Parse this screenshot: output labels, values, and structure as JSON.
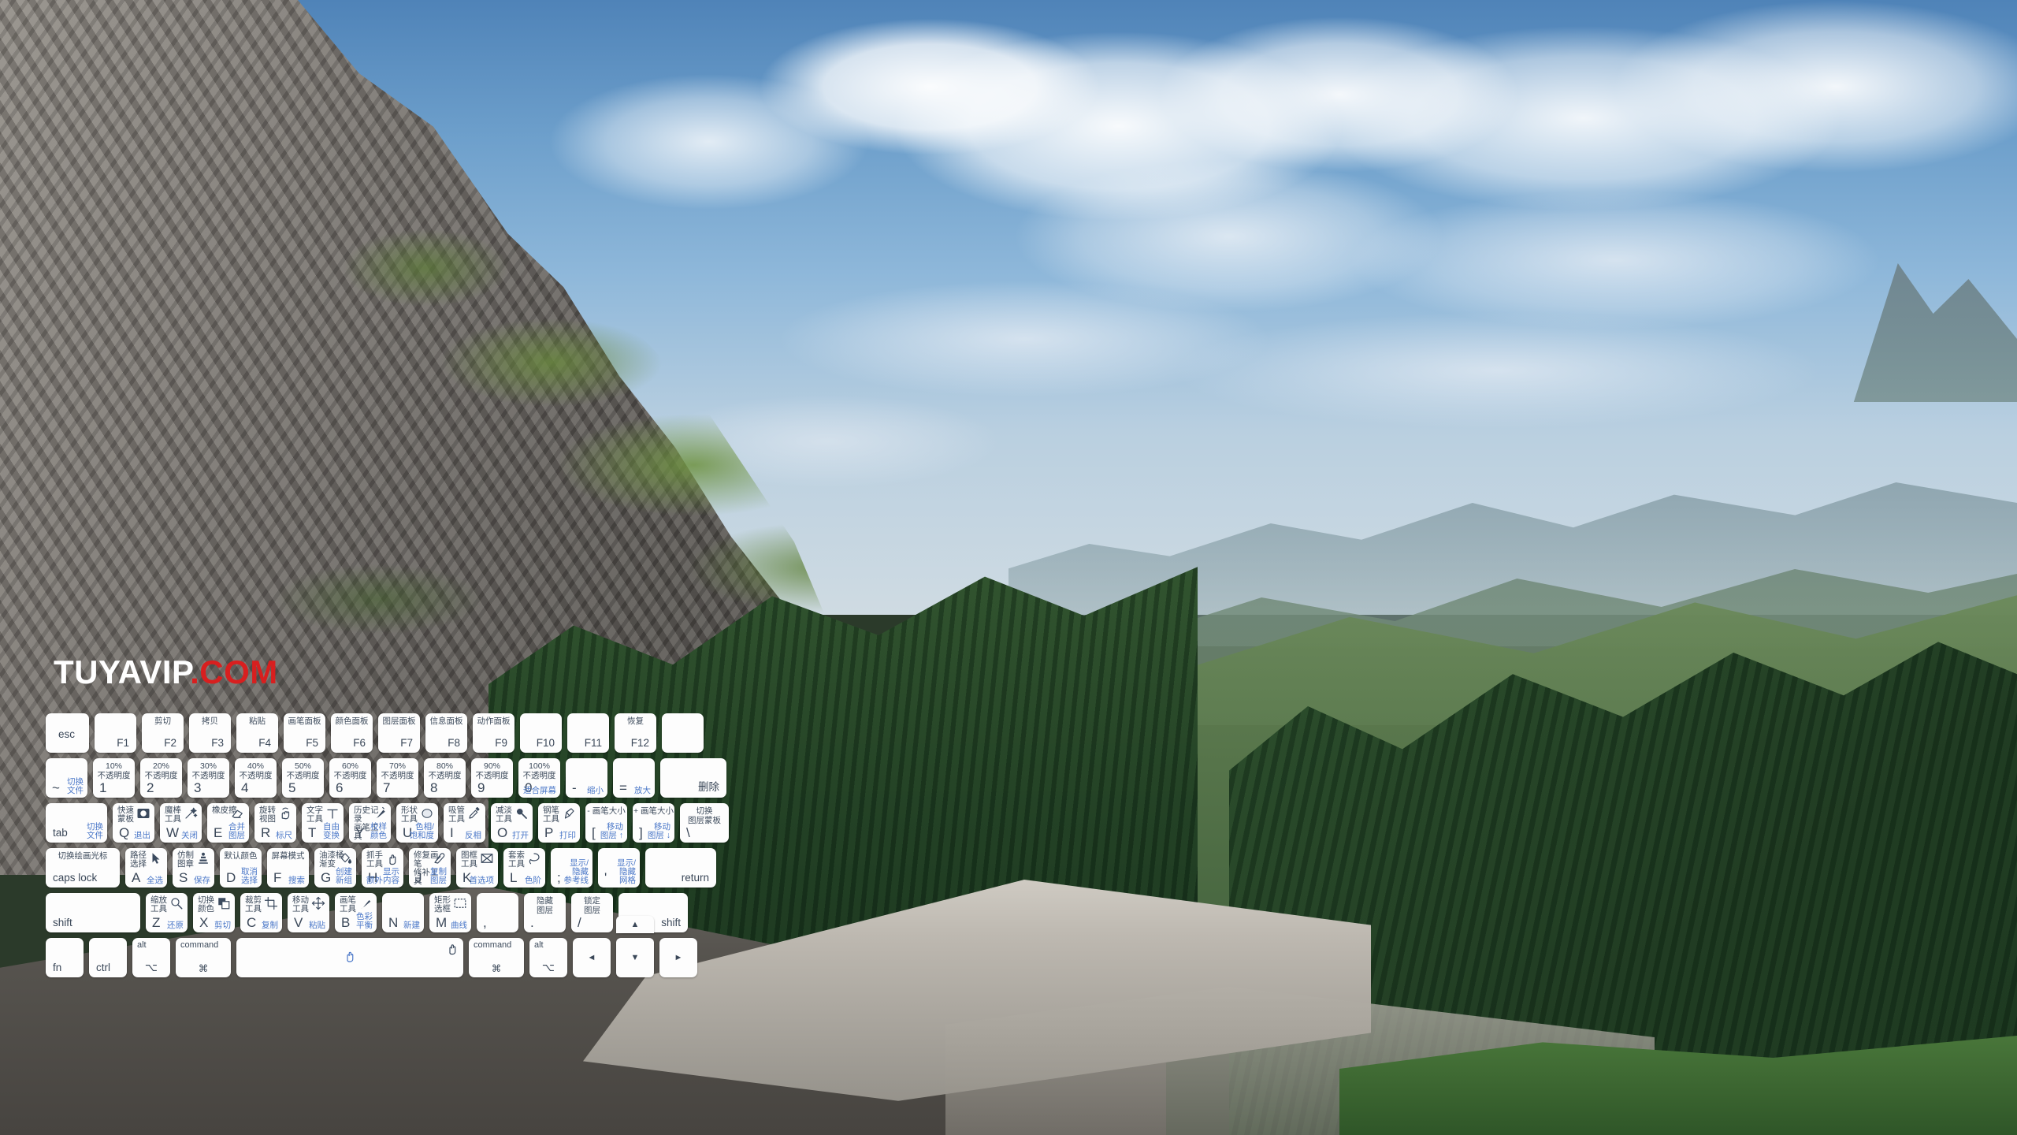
{
  "watermark": {
    "name": "TUYAVIP",
    "tld": ".COM"
  },
  "keyboard": {
    "fn_row": [
      {
        "key": "esc",
        "top": "",
        "wide": "esc"
      },
      {
        "key": "F1",
        "top": ""
      },
      {
        "key": "F2",
        "top": "剪切"
      },
      {
        "key": "F3",
        "top": "拷贝"
      },
      {
        "key": "F4",
        "top": "粘贴"
      },
      {
        "key": "F5",
        "top": "画笔面板"
      },
      {
        "key": "F6",
        "top": "颜色面板"
      },
      {
        "key": "F7",
        "top": "图层面板"
      },
      {
        "key": "F8",
        "top": "信息面板"
      },
      {
        "key": "F9",
        "top": "动作面板"
      },
      {
        "key": "F10",
        "top": ""
      },
      {
        "key": "F11",
        "top": ""
      },
      {
        "key": "F12",
        "top": "恢复"
      },
      {
        "key": "",
        "top": ""
      }
    ],
    "num_row": [
      {
        "key": "~",
        "top": "",
        "sub": "切换\n文件",
        "subcolor": "blue"
      },
      {
        "key": "1",
        "top": "10%\n不透明度"
      },
      {
        "key": "2",
        "top": "20%\n不透明度"
      },
      {
        "key": "3",
        "top": "30%\n不透明度"
      },
      {
        "key": "4",
        "top": "40%\n不透明度"
      },
      {
        "key": "5",
        "top": "50%\n不透明度"
      },
      {
        "key": "6",
        "top": "60%\n不透明度"
      },
      {
        "key": "7",
        "top": "70%\n不透明度"
      },
      {
        "key": "8",
        "top": "80%\n不透明度"
      },
      {
        "key": "9",
        "top": "90%\n不透明度"
      },
      {
        "key": "0",
        "top": "100%\n不透明度",
        "sub": "适合屏幕",
        "subcolor": "blue"
      },
      {
        "key": "-",
        "top": "",
        "sub": "缩小",
        "subcolor": "blue"
      },
      {
        "key": "=",
        "top": "",
        "sub": "放大",
        "subcolor": "blue"
      },
      {
        "key": "删除",
        "top": "",
        "wide": "del"
      }
    ],
    "qwerty_row": [
      {
        "key": "tab",
        "wide": "tab",
        "sub": "切换\n文件",
        "subcolor": "blue"
      },
      {
        "key": "Q",
        "top": "快速\n蒙板",
        "icon": "quick-mask-icon",
        "sub": "退出",
        "subcolor": "blue"
      },
      {
        "key": "W",
        "top": "魔棒\n工具",
        "icon": "magic-wand-icon",
        "sub": "关闭",
        "subcolor": "blue"
      },
      {
        "key": "E",
        "top": "橡皮擦",
        "icon": "eraser-icon",
        "sub": "合并\n图层",
        "subcolor": "blue"
      },
      {
        "key": "R",
        "top": "旋转\n视图",
        "icon": "rotate-view-icon",
        "sub": "标尺",
        "subcolor": "blue"
      },
      {
        "key": "T",
        "top": "文字\n工具",
        "icon": "text-tool-icon",
        "sub": "自由\n变换",
        "subcolor": "blue"
      },
      {
        "key": "Y",
        "top": "历史记录\n画笔工具",
        "icon": "history-brush-icon",
        "sub": "校样\n颜色",
        "subcolor": "blue"
      },
      {
        "key": "U",
        "top": "形状\n工具",
        "icon": "shape-tool-icon",
        "sub": "色相/\n饱和度",
        "subcolor": "blue"
      },
      {
        "key": "I",
        "top": "吸管\n工具",
        "icon": "eyedropper-icon",
        "sub": "反相",
        "subcolor": "blue"
      },
      {
        "key": "O",
        "top": "减淡\n工具",
        "icon": "dodge-tool-icon",
        "sub": "打开",
        "subcolor": "blue"
      },
      {
        "key": "P",
        "top": "钢笔\n工具",
        "icon": "pen-tool-icon",
        "sub": "打印",
        "subcolor": "blue"
      },
      {
        "key": "[",
        "top": "- 画笔大小",
        "sub": "移动\n图层 ↑",
        "subcolor": "blue"
      },
      {
        "key": "]",
        "top": "+ 画笔大小",
        "sub": "移动\n图层 ↓",
        "subcolor": "blue"
      },
      {
        "key": "\\",
        "top": "切换\n图层蒙板",
        "wide": "bsl"
      }
    ],
    "home_row": [
      {
        "key": "caps lock",
        "wide": "caps",
        "top": "切换绘画光标"
      },
      {
        "key": "A",
        "top": "路径\n选择",
        "icon": "path-select-icon",
        "sub": "全选",
        "subcolor": "blue"
      },
      {
        "key": "S",
        "top": "仿制\n图章",
        "icon": "clone-stamp-icon",
        "sub": "保存",
        "subcolor": "blue"
      },
      {
        "key": "D",
        "top": "默认颜色",
        "sub": "取消\n选择",
        "subcolor": "blue"
      },
      {
        "key": "F",
        "top": "屏幕模式",
        "sub": "搜索",
        "subcolor": "blue"
      },
      {
        "key": "G",
        "top": "油漆桶\n渐变",
        "icon": "paint-bucket-icon",
        "sub": "创建\n新组",
        "subcolor": "blue"
      },
      {
        "key": "H",
        "top": "抓手\n工具",
        "icon": "hand-tool-icon",
        "sub": "显示\n额外内容",
        "subcolor": "blue"
      },
      {
        "key": "J",
        "top": "修复画笔\n修补工具",
        "icon": "healing-brush-icon",
        "sub": "复制\n图层",
        "subcolor": "blue"
      },
      {
        "key": "K",
        "top": "图框\n工具",
        "icon": "frame-tool-icon",
        "sub": "首选项",
        "subcolor": "blue"
      },
      {
        "key": "L",
        "top": "套索\n工具",
        "icon": "lasso-tool-icon",
        "sub": "色阶",
        "subcolor": "blue"
      },
      {
        "key": ";",
        "sub": "显示/\n隐藏\n参考线",
        "subcolor": "blue"
      },
      {
        "key": "'",
        "sub": "显示/\n隐藏\n网格",
        "subcolor": "blue"
      },
      {
        "key": "return",
        "wide": "ret"
      }
    ],
    "shift_row": [
      {
        "key": "shift",
        "wide": "shift-l"
      },
      {
        "key": "Z",
        "top": "缩放\n工具",
        "icon": "zoom-tool-icon",
        "sub": "还原",
        "subcolor": "blue"
      },
      {
        "key": "X",
        "top": "切换\n颜色",
        "icon": "swap-colors-icon",
        "sub": "剪切",
        "subcolor": "blue"
      },
      {
        "key": "C",
        "top": "裁剪\n工具",
        "icon": "crop-tool-icon",
        "sub": "复制",
        "subcolor": "blue"
      },
      {
        "key": "V",
        "top": "移动\n工具",
        "icon": "move-tool-icon",
        "sub": "粘贴",
        "subcolor": "blue"
      },
      {
        "key": "B",
        "top": "画笔\n工具",
        "icon": "brush-tool-icon",
        "sub": "色彩\n平衡",
        "subcolor": "blue"
      },
      {
        "key": "N",
        "sub": "新建",
        "subcolor": "blue"
      },
      {
        "key": "M",
        "top": "矩形\n选框",
        "icon": "marquee-tool-icon",
        "sub": "曲线",
        "subcolor": "blue"
      },
      {
        "key": ",",
        "sub": "",
        "subcolor": "blue"
      },
      {
        "key": ".",
        "top": "隐藏\n图层",
        "subcolor": "blue"
      },
      {
        "key": "/",
        "top": "锁定\n图层",
        "subcolor": "blue"
      },
      {
        "key": "shift",
        "wide": "shift-r"
      }
    ],
    "bottom_row": [
      {
        "key": "fn",
        "wide": "bot-fn"
      },
      {
        "key": "ctrl",
        "wide": "ctrl"
      },
      {
        "key": "alt",
        "glyph": "⌥",
        "wide": "alt"
      },
      {
        "key": "command",
        "glyph": "⌘",
        "wide": "cmd"
      },
      {
        "key": "",
        "wide": "space",
        "icon": "hand-cursor-icon"
      },
      {
        "key": "command",
        "glyph": "⌘",
        "wide": "cmd"
      },
      {
        "key": "alt",
        "glyph": "⌥",
        "wide": "alt"
      }
    ],
    "arrows": {
      "up": "▲",
      "down": "▼",
      "left": "◄",
      "right": "►"
    }
  }
}
